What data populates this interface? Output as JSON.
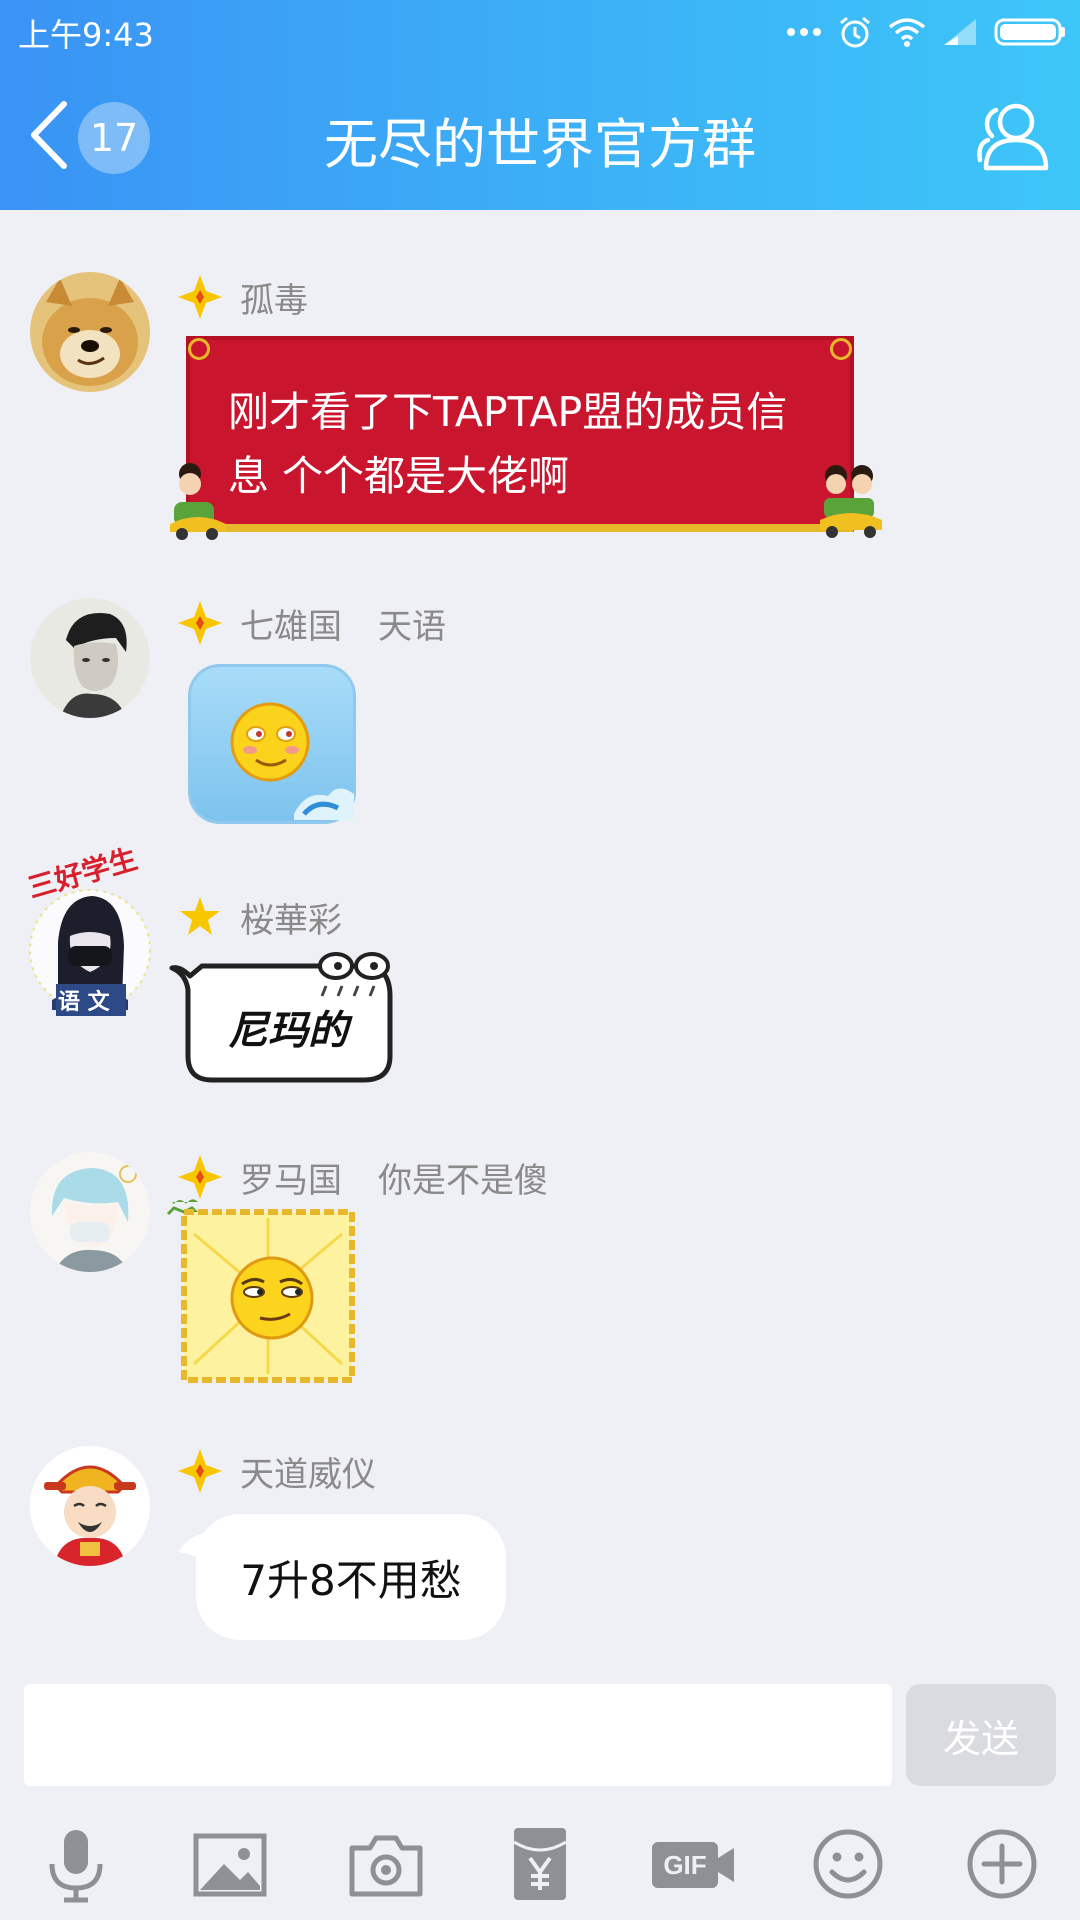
{
  "status_bar": {
    "time": "上午9:43"
  },
  "header": {
    "unread_count": "17",
    "title": "无尽的世界官方群"
  },
  "messages": [
    {
      "name": "孤毒",
      "text": "刚才看了下TAPTAP盟的成员信息  个个都是大佬啊"
    },
    {
      "name": "七雄国",
      "title": "天语"
    },
    {
      "name": "桜華彩",
      "sticker_text": "尼玛的",
      "avatar_label_top": "三好学生",
      "avatar_label_bottom": "语 文"
    },
    {
      "name": "罗马国",
      "title": "你是不是傻"
    },
    {
      "name": "天道威仪",
      "text": "7升8不用愁"
    }
  ],
  "input": {
    "value": "",
    "send_label": "发送"
  },
  "toolbar": {
    "items": [
      "microphone-icon",
      "image-icon",
      "camera-icon",
      "red-packet-icon",
      "gif-icon",
      "emoji-icon",
      "plus-icon"
    ]
  },
  "colors": {
    "header_start": "#3a93f5",
    "header_end": "#3dc6f8",
    "bubble_red": "#c9152e",
    "badge_gold": "#f9c700"
  }
}
